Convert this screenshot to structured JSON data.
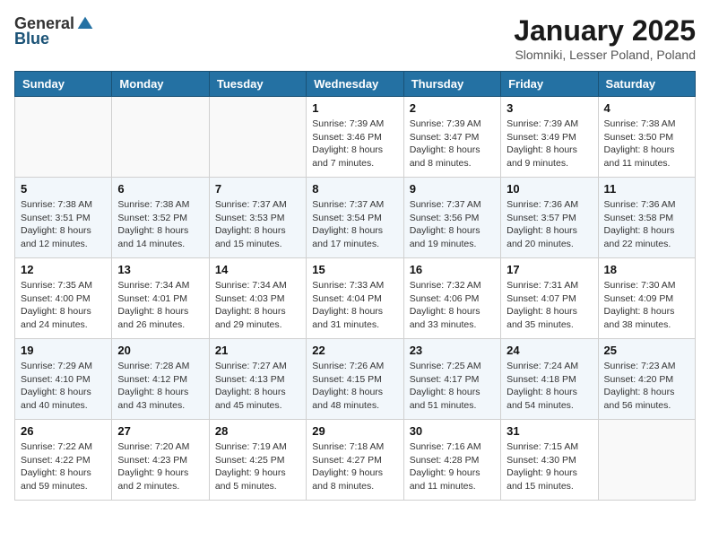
{
  "header": {
    "logo_general": "General",
    "logo_blue": "Blue",
    "month_title": "January 2025",
    "subtitle": "Slomniki, Lesser Poland, Poland"
  },
  "days_of_week": [
    "Sunday",
    "Monday",
    "Tuesday",
    "Wednesday",
    "Thursday",
    "Friday",
    "Saturday"
  ],
  "weeks": [
    [
      {
        "day": "",
        "content": ""
      },
      {
        "day": "",
        "content": ""
      },
      {
        "day": "",
        "content": ""
      },
      {
        "day": "1",
        "content": "Sunrise: 7:39 AM\nSunset: 3:46 PM\nDaylight: 8 hours\nand 7 minutes."
      },
      {
        "day": "2",
        "content": "Sunrise: 7:39 AM\nSunset: 3:47 PM\nDaylight: 8 hours\nand 8 minutes."
      },
      {
        "day": "3",
        "content": "Sunrise: 7:39 AM\nSunset: 3:49 PM\nDaylight: 8 hours\nand 9 minutes."
      },
      {
        "day": "4",
        "content": "Sunrise: 7:38 AM\nSunset: 3:50 PM\nDaylight: 8 hours\nand 11 minutes."
      }
    ],
    [
      {
        "day": "5",
        "content": "Sunrise: 7:38 AM\nSunset: 3:51 PM\nDaylight: 8 hours\nand 12 minutes."
      },
      {
        "day": "6",
        "content": "Sunrise: 7:38 AM\nSunset: 3:52 PM\nDaylight: 8 hours\nand 14 minutes."
      },
      {
        "day": "7",
        "content": "Sunrise: 7:37 AM\nSunset: 3:53 PM\nDaylight: 8 hours\nand 15 minutes."
      },
      {
        "day": "8",
        "content": "Sunrise: 7:37 AM\nSunset: 3:54 PM\nDaylight: 8 hours\nand 17 minutes."
      },
      {
        "day": "9",
        "content": "Sunrise: 7:37 AM\nSunset: 3:56 PM\nDaylight: 8 hours\nand 19 minutes."
      },
      {
        "day": "10",
        "content": "Sunrise: 7:36 AM\nSunset: 3:57 PM\nDaylight: 8 hours\nand 20 minutes."
      },
      {
        "day": "11",
        "content": "Sunrise: 7:36 AM\nSunset: 3:58 PM\nDaylight: 8 hours\nand 22 minutes."
      }
    ],
    [
      {
        "day": "12",
        "content": "Sunrise: 7:35 AM\nSunset: 4:00 PM\nDaylight: 8 hours\nand 24 minutes."
      },
      {
        "day": "13",
        "content": "Sunrise: 7:34 AM\nSunset: 4:01 PM\nDaylight: 8 hours\nand 26 minutes."
      },
      {
        "day": "14",
        "content": "Sunrise: 7:34 AM\nSunset: 4:03 PM\nDaylight: 8 hours\nand 29 minutes."
      },
      {
        "day": "15",
        "content": "Sunrise: 7:33 AM\nSunset: 4:04 PM\nDaylight: 8 hours\nand 31 minutes."
      },
      {
        "day": "16",
        "content": "Sunrise: 7:32 AM\nSunset: 4:06 PM\nDaylight: 8 hours\nand 33 minutes."
      },
      {
        "day": "17",
        "content": "Sunrise: 7:31 AM\nSunset: 4:07 PM\nDaylight: 8 hours\nand 35 minutes."
      },
      {
        "day": "18",
        "content": "Sunrise: 7:30 AM\nSunset: 4:09 PM\nDaylight: 8 hours\nand 38 minutes."
      }
    ],
    [
      {
        "day": "19",
        "content": "Sunrise: 7:29 AM\nSunset: 4:10 PM\nDaylight: 8 hours\nand 40 minutes."
      },
      {
        "day": "20",
        "content": "Sunrise: 7:28 AM\nSunset: 4:12 PM\nDaylight: 8 hours\nand 43 minutes."
      },
      {
        "day": "21",
        "content": "Sunrise: 7:27 AM\nSunset: 4:13 PM\nDaylight: 8 hours\nand 45 minutes."
      },
      {
        "day": "22",
        "content": "Sunrise: 7:26 AM\nSunset: 4:15 PM\nDaylight: 8 hours\nand 48 minutes."
      },
      {
        "day": "23",
        "content": "Sunrise: 7:25 AM\nSunset: 4:17 PM\nDaylight: 8 hours\nand 51 minutes."
      },
      {
        "day": "24",
        "content": "Sunrise: 7:24 AM\nSunset: 4:18 PM\nDaylight: 8 hours\nand 54 minutes."
      },
      {
        "day": "25",
        "content": "Sunrise: 7:23 AM\nSunset: 4:20 PM\nDaylight: 8 hours\nand 56 minutes."
      }
    ],
    [
      {
        "day": "26",
        "content": "Sunrise: 7:22 AM\nSunset: 4:22 PM\nDaylight: 8 hours\nand 59 minutes."
      },
      {
        "day": "27",
        "content": "Sunrise: 7:20 AM\nSunset: 4:23 PM\nDaylight: 9 hours\nand 2 minutes."
      },
      {
        "day": "28",
        "content": "Sunrise: 7:19 AM\nSunset: 4:25 PM\nDaylight: 9 hours\nand 5 minutes."
      },
      {
        "day": "29",
        "content": "Sunrise: 7:18 AM\nSunset: 4:27 PM\nDaylight: 9 hours\nand 8 minutes."
      },
      {
        "day": "30",
        "content": "Sunrise: 7:16 AM\nSunset: 4:28 PM\nDaylight: 9 hours\nand 11 minutes."
      },
      {
        "day": "31",
        "content": "Sunrise: 7:15 AM\nSunset: 4:30 PM\nDaylight: 9 hours\nand 15 minutes."
      },
      {
        "day": "",
        "content": ""
      }
    ]
  ]
}
